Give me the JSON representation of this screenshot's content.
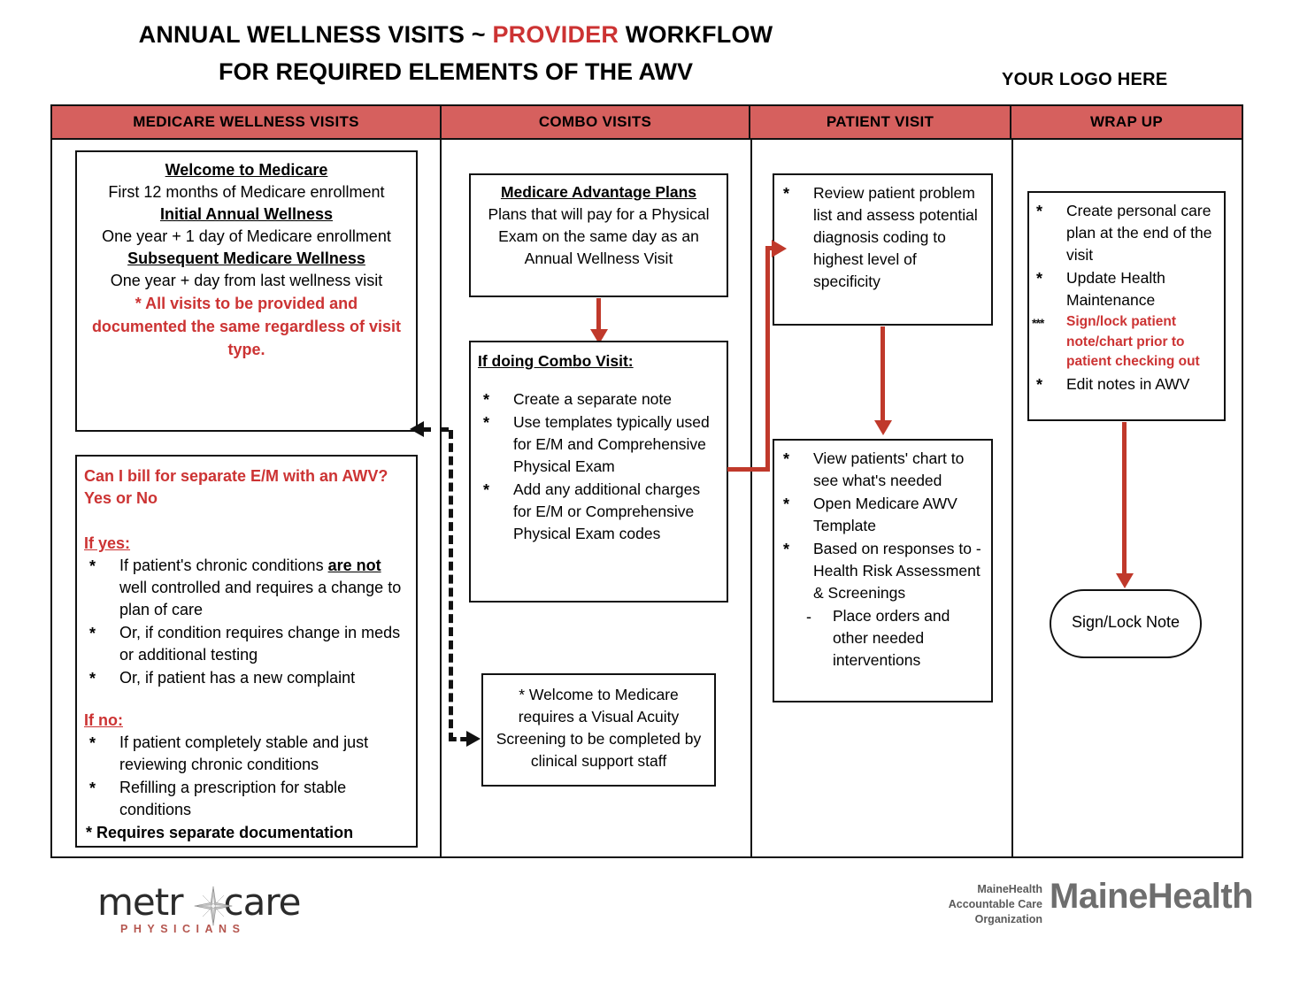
{
  "title": {
    "line1_a": "ANNUAL WELLNESS VISITS ~ ",
    "line1_accent": "PROVIDER",
    "line1_b": " WORKFLOW",
    "line2": "FOR REQUIRED ELEMENTS OF THE AWV",
    "logo_placeholder": "YOUR LOGO HERE"
  },
  "columns": [
    {
      "header": "MEDICARE WELLNESS VISITS"
    },
    {
      "header": "COMBO VISITS"
    },
    {
      "header": "PATIENT VISIT"
    },
    {
      "header": "WRAP UP"
    }
  ],
  "medicare_wellness": {
    "box1": {
      "h1": "Welcome to Medicare",
      "p1": "First 12 months of Medicare enrollment",
      "h2": "Initial Annual Wellness",
      "p2": "One year + 1 day of Medicare enrollment",
      "h3": "Subsequent Medicare Wellness",
      "p3": "One year + day from last wellness visit",
      "note": "* All visits to be provided and documented the same regardless of visit type."
    },
    "box2": {
      "question": "Can I bill for separate E/M with an AWV?  Yes or No",
      "yes_label": "If yes:",
      "yes_items": [
        "If patient's chronic conditions are not well controlled and requires a change to plan of care",
        "Or, if condition requires change    in meds or additional testing",
        "Or, if patient has a new complaint"
      ],
      "yes_item1_pre": "If patient's chronic conditions ",
      "yes_item1_underline": "are not",
      "yes_item1_post": " well controlled and requires a change to plan of care",
      "no_label": "If no:",
      "no_items": [
        "If patient completely stable and just reviewing chronic conditions",
        "Refilling a prescription for stable conditions"
      ],
      "footer": "* Requires separate documentation"
    }
  },
  "combo_visits": {
    "box1": {
      "heading": "Medicare Advantage Plans",
      "body": "Plans that will pay for a Physical Exam on the same day as an Annual Wellness Visit"
    },
    "box2": {
      "heading": "If doing Combo Visit:",
      "items": [
        "Create a separate note",
        "Use templates typically used for  E/M and Comprehensive Physical Exam",
        "Add any additional charges for E/M or Comprehensive Physical Exam codes"
      ]
    },
    "box3": {
      "text": "* Welcome to Medicare requires a Visual Acuity Screening to be completed by clinical support staff"
    }
  },
  "patient_visit": {
    "box1": {
      "items": [
        "Review patient problem list and assess potential diagnosis coding to highest level of specificity"
      ]
    },
    "box2": {
      "items": [
        "View patients' chart to see what's needed",
        "Open Medicare AWV Template",
        "Based on responses to - Health Risk Assessment & Screenings"
      ],
      "subitem": "Place orders and other needed interventions"
    }
  },
  "wrap_up": {
    "box1": {
      "items": [
        "Create personal care plan at the end of the visit",
        "Update Health Maintenance"
      ],
      "red_item": "Sign/lock patient note/chart prior to patient checking out",
      "red_item_marker": "***",
      "last_item": "Edit notes in AWV"
    },
    "terminal": "Sign/Lock Note"
  },
  "footer": {
    "metro_word_1": "metr",
    "metro_word_2": "care",
    "metro_sub": "PHYSICIANS",
    "mh_small_l1": "MaineHealth",
    "mh_small_l2": "Accountable Care",
    "mh_small_l3": "Organization",
    "mh_big": "MaineHealth"
  },
  "colors": {
    "header_red": "#d6605e",
    "accent_red": "#cc3333",
    "arrow_red": "#c0392b",
    "metro_sub_red": "#b5564f",
    "mh_gray": "#6e6e6e"
  }
}
